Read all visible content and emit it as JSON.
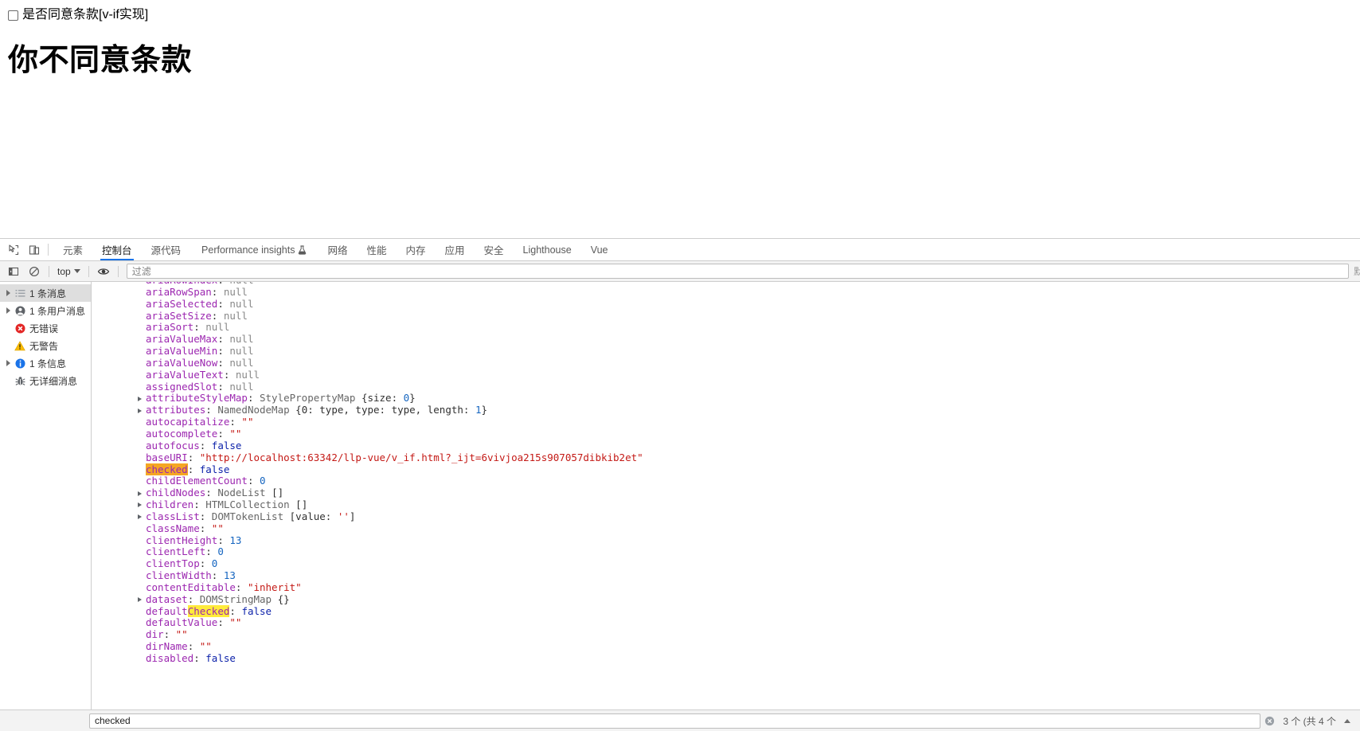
{
  "page": {
    "checkbox_label": "是否同意条款[v-if实现]",
    "checkbox_checked": false,
    "heading": "你不同意条款"
  },
  "devtools": {
    "tabs": [
      {
        "label": "元素",
        "active": false,
        "icon": null
      },
      {
        "label": "控制台",
        "active": true,
        "icon": null
      },
      {
        "label": "源代码",
        "active": false,
        "icon": null
      },
      {
        "label": "Performance insights",
        "active": false,
        "icon": "beaker-icon"
      },
      {
        "label": "网络",
        "active": false,
        "icon": null
      },
      {
        "label": "性能",
        "active": false,
        "icon": null
      },
      {
        "label": "内存",
        "active": false,
        "icon": null
      },
      {
        "label": "应用",
        "active": false,
        "icon": null
      },
      {
        "label": "安全",
        "active": false,
        "icon": null
      },
      {
        "label": "Lighthouse",
        "active": false,
        "icon": null
      },
      {
        "label": "Vue",
        "active": false,
        "icon": null
      }
    ],
    "toolbar_icons": {
      "inspect": "inspect-element-icon",
      "device": "device-toolbar-icon"
    },
    "filterbar": {
      "sidebar_toggle_icon": "console-sidebar-toggle-icon",
      "clear_icon": "clear-console-icon",
      "context_value": "top",
      "eye_icon": "live-expression-eye-icon",
      "filter_placeholder": "过滤",
      "filter_value": "",
      "levels_label": "默"
    },
    "sidebar": [
      {
        "label": "1 条消息",
        "icon": "message-list-icon",
        "expandable": true,
        "selected": true
      },
      {
        "label": "1 条用户消息",
        "icon": "user-message-icon",
        "expandable": true,
        "selected": false
      },
      {
        "label": "无错误",
        "icon": "error-icon",
        "expandable": false,
        "selected": false
      },
      {
        "label": "无警告",
        "icon": "warning-icon",
        "expandable": false,
        "selected": false
      },
      {
        "label": "1 条信息",
        "icon": "info-icon",
        "expandable": true,
        "selected": false
      },
      {
        "label": "无详细消息",
        "icon": "verbose-bug-icon",
        "expandable": false,
        "selected": false
      }
    ],
    "search": {
      "value": "checked",
      "count": "3 个 (共 4 个",
      "clear_icon": "close-icon",
      "prev_icon": "chevron-up-icon"
    },
    "log_rows": [
      {
        "arrow": false,
        "clipped": true,
        "tokens": [
          {
            "t": "ariaRowIndex",
            "c": "prop"
          },
          {
            "t": ": ",
            "c": "plain"
          },
          {
            "t": "null",
            "c": "null"
          }
        ]
      },
      {
        "arrow": false,
        "tokens": [
          {
            "t": "ariaRowSpan",
            "c": "prop"
          },
          {
            "t": ": ",
            "c": "plain"
          },
          {
            "t": "null",
            "c": "null"
          }
        ]
      },
      {
        "arrow": false,
        "tokens": [
          {
            "t": "ariaSelected",
            "c": "prop"
          },
          {
            "t": ": ",
            "c": "plain"
          },
          {
            "t": "null",
            "c": "null"
          }
        ]
      },
      {
        "arrow": false,
        "tokens": [
          {
            "t": "ariaSetSize",
            "c": "prop"
          },
          {
            "t": ": ",
            "c": "plain"
          },
          {
            "t": "null",
            "c": "null"
          }
        ]
      },
      {
        "arrow": false,
        "tokens": [
          {
            "t": "ariaSort",
            "c": "prop"
          },
          {
            "t": ": ",
            "c": "plain"
          },
          {
            "t": "null",
            "c": "null"
          }
        ]
      },
      {
        "arrow": false,
        "tokens": [
          {
            "t": "ariaValueMax",
            "c": "prop"
          },
          {
            "t": ": ",
            "c": "plain"
          },
          {
            "t": "null",
            "c": "null"
          }
        ]
      },
      {
        "arrow": false,
        "tokens": [
          {
            "t": "ariaValueMin",
            "c": "prop"
          },
          {
            "t": ": ",
            "c": "plain"
          },
          {
            "t": "null",
            "c": "null"
          }
        ]
      },
      {
        "arrow": false,
        "tokens": [
          {
            "t": "ariaValueNow",
            "c": "prop"
          },
          {
            "t": ": ",
            "c": "plain"
          },
          {
            "t": "null",
            "c": "null"
          }
        ]
      },
      {
        "arrow": false,
        "tokens": [
          {
            "t": "ariaValueText",
            "c": "prop"
          },
          {
            "t": ": ",
            "c": "plain"
          },
          {
            "t": "null",
            "c": "null"
          }
        ]
      },
      {
        "arrow": false,
        "tokens": [
          {
            "t": "assignedSlot",
            "c": "prop"
          },
          {
            "t": ": ",
            "c": "plain"
          },
          {
            "t": "null",
            "c": "null"
          }
        ]
      },
      {
        "arrow": true,
        "tokens": [
          {
            "t": "attributeStyleMap",
            "c": "prop"
          },
          {
            "t": ": ",
            "c": "plain"
          },
          {
            "t": "StylePropertyMap ",
            "c": "class"
          },
          {
            "t": "{size: ",
            "c": "plain"
          },
          {
            "t": "0",
            "c": "num"
          },
          {
            "t": "}",
            "c": "plain"
          }
        ]
      },
      {
        "arrow": true,
        "tokens": [
          {
            "t": "attributes",
            "c": "prop"
          },
          {
            "t": ": ",
            "c": "plain"
          },
          {
            "t": "NamedNodeMap ",
            "c": "class"
          },
          {
            "t": "{0: type, type: type, length: ",
            "c": "plain"
          },
          {
            "t": "1",
            "c": "num"
          },
          {
            "t": "}",
            "c": "plain"
          }
        ]
      },
      {
        "arrow": false,
        "tokens": [
          {
            "t": "autocapitalize",
            "c": "prop"
          },
          {
            "t": ": ",
            "c": "plain"
          },
          {
            "t": "\"\"",
            "c": "str"
          }
        ]
      },
      {
        "arrow": false,
        "tokens": [
          {
            "t": "autocomplete",
            "c": "prop"
          },
          {
            "t": ": ",
            "c": "plain"
          },
          {
            "t": "\"\"",
            "c": "str"
          }
        ]
      },
      {
        "arrow": false,
        "tokens": [
          {
            "t": "autofocus",
            "c": "prop"
          },
          {
            "t": ": ",
            "c": "plain"
          },
          {
            "t": "false",
            "c": "bool"
          }
        ]
      },
      {
        "arrow": false,
        "tokens": [
          {
            "t": "baseURI",
            "c": "prop"
          },
          {
            "t": ": ",
            "c": "plain"
          },
          {
            "t": "\"http://localhost:63342/llp-vue/v_if.html?_ijt=6vivjoa215s907057dibkib2et\"",
            "c": "str"
          }
        ]
      },
      {
        "arrow": false,
        "tokens": [
          {
            "t": "checked",
            "c": "prop",
            "hl": "active"
          },
          {
            "t": ": ",
            "c": "plain"
          },
          {
            "t": "false",
            "c": "bool"
          }
        ]
      },
      {
        "arrow": false,
        "tokens": [
          {
            "t": "childElementCount",
            "c": "prop"
          },
          {
            "t": ": ",
            "c": "plain"
          },
          {
            "t": "0",
            "c": "num"
          }
        ]
      },
      {
        "arrow": true,
        "tokens": [
          {
            "t": "childNodes",
            "c": "prop"
          },
          {
            "t": ": ",
            "c": "plain"
          },
          {
            "t": "NodeList ",
            "c": "class"
          },
          {
            "t": "[]",
            "c": "plain"
          }
        ]
      },
      {
        "arrow": true,
        "tokens": [
          {
            "t": "children",
            "c": "prop"
          },
          {
            "t": ": ",
            "c": "plain"
          },
          {
            "t": "HTMLCollection ",
            "c": "class"
          },
          {
            "t": "[]",
            "c": "plain"
          }
        ]
      },
      {
        "arrow": true,
        "tokens": [
          {
            "t": "classList",
            "c": "prop"
          },
          {
            "t": ": ",
            "c": "plain"
          },
          {
            "t": "DOMTokenList ",
            "c": "class"
          },
          {
            "t": "[value: ",
            "c": "plain"
          },
          {
            "t": "''",
            "c": "str"
          },
          {
            "t": "]",
            "c": "plain"
          }
        ]
      },
      {
        "arrow": false,
        "tokens": [
          {
            "t": "className",
            "c": "prop"
          },
          {
            "t": ": ",
            "c": "plain"
          },
          {
            "t": "\"\"",
            "c": "str"
          }
        ]
      },
      {
        "arrow": false,
        "tokens": [
          {
            "t": "clientHeight",
            "c": "prop"
          },
          {
            "t": ": ",
            "c": "plain"
          },
          {
            "t": "13",
            "c": "num"
          }
        ]
      },
      {
        "arrow": false,
        "tokens": [
          {
            "t": "clientLeft",
            "c": "prop"
          },
          {
            "t": ": ",
            "c": "plain"
          },
          {
            "t": "0",
            "c": "num"
          }
        ]
      },
      {
        "arrow": false,
        "tokens": [
          {
            "t": "clientTop",
            "c": "prop"
          },
          {
            "t": ": ",
            "c": "plain"
          },
          {
            "t": "0",
            "c": "num"
          }
        ]
      },
      {
        "arrow": false,
        "tokens": [
          {
            "t": "clientWidth",
            "c": "prop"
          },
          {
            "t": ": ",
            "c": "plain"
          },
          {
            "t": "13",
            "c": "num"
          }
        ]
      },
      {
        "arrow": false,
        "tokens": [
          {
            "t": "contentEditable",
            "c": "prop"
          },
          {
            "t": ": ",
            "c": "plain"
          },
          {
            "t": "\"inherit\"",
            "c": "str"
          }
        ]
      },
      {
        "arrow": true,
        "tokens": [
          {
            "t": "dataset",
            "c": "prop"
          },
          {
            "t": ": ",
            "c": "plain"
          },
          {
            "t": "DOMStringMap ",
            "c": "class"
          },
          {
            "t": "{}",
            "c": "plain"
          }
        ]
      },
      {
        "arrow": false,
        "tokens": [
          {
            "t": "default",
            "c": "prop"
          },
          {
            "t": "Checked",
            "c": "prop",
            "hl": "match"
          },
          {
            "t": ": ",
            "c": "plain"
          },
          {
            "t": "false",
            "c": "bool"
          }
        ]
      },
      {
        "arrow": false,
        "tokens": [
          {
            "t": "defaultValue",
            "c": "prop"
          },
          {
            "t": ": ",
            "c": "plain"
          },
          {
            "t": "\"\"",
            "c": "str"
          }
        ]
      },
      {
        "arrow": false,
        "tokens": [
          {
            "t": "dir",
            "c": "prop"
          },
          {
            "t": ": ",
            "c": "plain"
          },
          {
            "t": "\"\"",
            "c": "str"
          }
        ]
      },
      {
        "arrow": false,
        "tokens": [
          {
            "t": "dirName",
            "c": "prop"
          },
          {
            "t": ": ",
            "c": "plain"
          },
          {
            "t": "\"\"",
            "c": "str"
          }
        ]
      },
      {
        "arrow": false,
        "tokens": [
          {
            "t": "disabled",
            "c": "prop"
          },
          {
            "t": ": ",
            "c": "plain"
          },
          {
            "t": "false",
            "c": "bool"
          }
        ]
      }
    ]
  }
}
